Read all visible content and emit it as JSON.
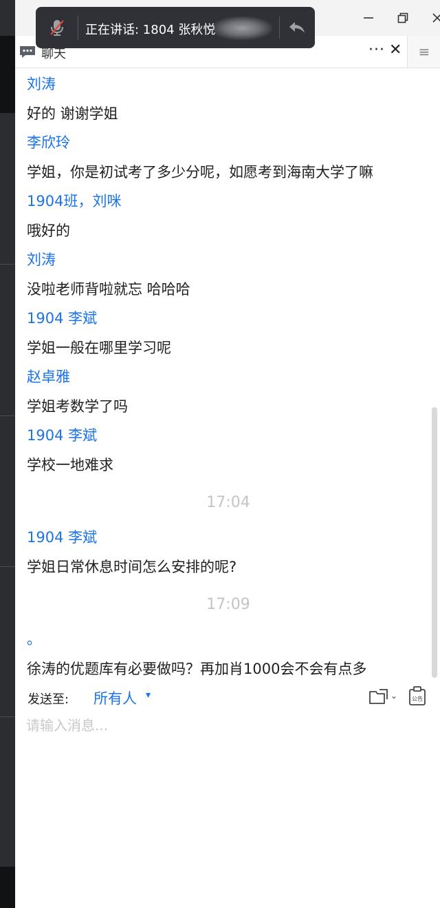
{
  "window": {
    "minimize_icon": "minimize-icon",
    "maximize_icon": "restore-icon",
    "close_icon": "close-icon"
  },
  "speaking_bar": {
    "text": "正在讲话: 1804 张秋悦",
    "mic_icon": "mic-muted-icon",
    "undo_icon": "reply-icon"
  },
  "chat_header": {
    "title": "聊天",
    "more_label": "···",
    "close_label": "✕",
    "menu_label": "≡"
  },
  "messages": [
    {
      "type": "message",
      "sender": "刘涛",
      "text": "好的 谢谢学姐"
    },
    {
      "type": "message",
      "sender": "李欣玲",
      "text": "学姐，你是初试考了多少分呢，如愿考到海南大学了嘛"
    },
    {
      "type": "message",
      "sender": "1904班，刘咪",
      "text": "哦好的"
    },
    {
      "type": "message",
      "sender": "刘涛",
      "text": "没啦老师背啦就忘  哈哈哈"
    },
    {
      "type": "message",
      "sender": "1904   李斌",
      "text": "学姐一般在哪里学习呢"
    },
    {
      "type": "message",
      "sender": "赵卓雅",
      "text": "学姐考数学了吗"
    },
    {
      "type": "message",
      "sender": "1904   李斌",
      "text": "学校一地难求"
    },
    {
      "type": "time",
      "text": "17:04"
    },
    {
      "type": "message",
      "sender": "1904   李斌",
      "text": "学姐日常休息时间怎么安排的呢?"
    },
    {
      "type": "time",
      "text": "17:09"
    },
    {
      "type": "message",
      "sender": "。",
      "text": "徐涛的优题库有必要做吗？再加肖1000会不会有点多"
    }
  ],
  "composer": {
    "send_to_label": "发送至:",
    "send_to_value": "所有人",
    "send_to_caret": "▾",
    "file_icon": "folder-icon",
    "notice_icon": "announcement-icon",
    "notice_label": "公告",
    "input_placeholder": "请输入消息...",
    "input_value": ""
  },
  "colors": {
    "sender": "#1a73e8",
    "text": "#1f1f1f",
    "time": "#c4c4c4",
    "overlay": "#2f3136"
  }
}
